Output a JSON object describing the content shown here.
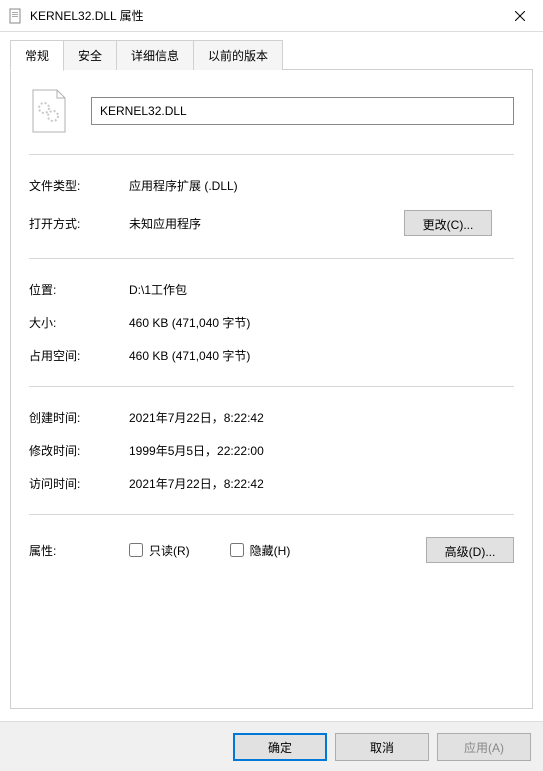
{
  "titlebar": {
    "title": "KERNEL32.DLL 属性"
  },
  "tabs": {
    "general": "常规",
    "security": "安全",
    "details": "详细信息",
    "previous_versions": "以前的版本"
  },
  "filename": "KERNEL32.DLL",
  "labels": {
    "file_type": "文件类型:",
    "opens_with": "打开方式:",
    "location": "位置:",
    "size": "大小:",
    "size_on_disk": "占用空间:",
    "created": "创建时间:",
    "modified": "修改时间:",
    "accessed": "访问时间:",
    "attributes": "属性:"
  },
  "values": {
    "file_type": "应用程序扩展 (.DLL)",
    "opens_with": "未知应用程序",
    "location": "D:\\1工作包",
    "size": "460 KB (471,040 字节)",
    "size_on_disk": "460 KB (471,040 字节)",
    "created": "2021年7月22日，8:22:42",
    "modified": "1999年5月5日，22:22:00",
    "accessed": "2021年7月22日，8:22:42"
  },
  "checkboxes": {
    "readonly": "只读(R)",
    "hidden": "隐藏(H)"
  },
  "buttons": {
    "change": "更改(C)...",
    "advanced": "高级(D)...",
    "ok": "确定",
    "cancel": "取消",
    "apply": "应用(A)"
  }
}
